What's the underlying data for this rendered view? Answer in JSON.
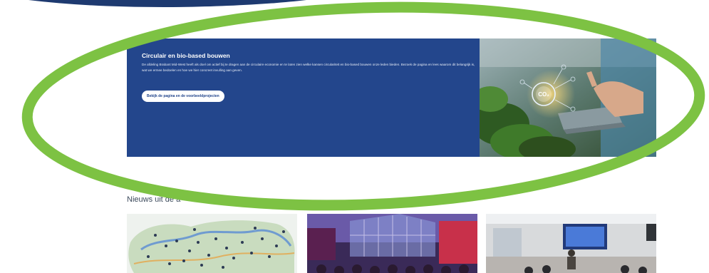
{
  "banner": {
    "title": "Circulair en bio-based bouwen",
    "body": "De afdeling Brabant Mid-West heeft als doel om actief bij te dragen aan de circulaire economie en te laten zien welke kansen circulariteit en bio-based bouwen onze leden bieden. Bezoek de pagina en lees waarom dit belangrijk is, wat we ermee bedoelen en hoe we hier concreet invulling aan geven.",
    "button_label": "Bekijk de pagina en de voorbeeldprojecten",
    "co2_label": "CO₂"
  },
  "news": {
    "section_title": "Nieuws uit de a"
  },
  "colors": {
    "banner_bg": "#23468c",
    "highlight_ellipse": "#7dc243"
  }
}
